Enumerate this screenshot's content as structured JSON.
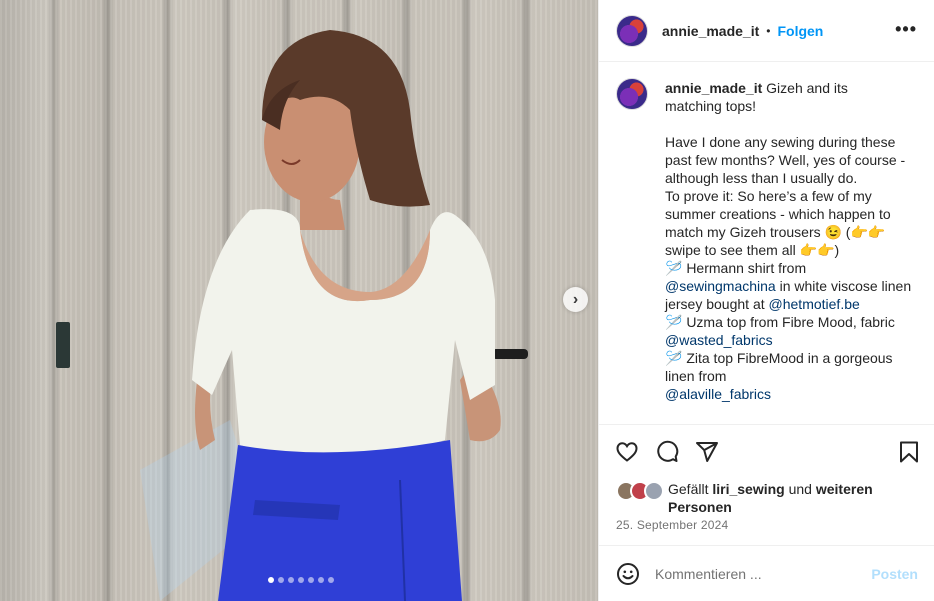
{
  "header": {
    "username": "annie_made_it",
    "separator": "•",
    "follow_label": "Folgen",
    "more_icon": "more-horizontal-icon"
  },
  "caption": {
    "username": "annie_made_it",
    "lines": [
      {
        "text": "Gizeh and its\nmatching tops!\n\nHave I done any sewing during these past few months? Well, yes of course - although less than I usually do.\nTo prove it: So here’s a few of my summer creations - which happen to match my Gizeh trousers 😉 (👉👉 swipe to see them all 👉👉)\n🪡 Hermann shirt from "
      },
      {
        "link": "@sewingmachina"
      },
      {
        "text": " in white viscose linen jersey bought at "
      },
      {
        "link": "@hetmotief.be"
      },
      {
        "text": "\n🪡 Uzma top from Fibre Mood, fabric "
      },
      {
        "link": "@wasted_fabrics"
      },
      {
        "text": "\n🪡 Zita top FibreMood in a gorgeous linen from\n"
      },
      {
        "link": "@alaville_fabrics"
      }
    ]
  },
  "likes": {
    "prefix": "Gefällt ",
    "user": "liri_sewing",
    "middle": " und ",
    "others": "weiteren Personen"
  },
  "date": "25. September 2024",
  "comment": {
    "placeholder": "Kommentieren ...",
    "post_label": "Posten"
  },
  "carousel": {
    "total_slides": 7,
    "active_slide": 1,
    "next_icon": "chevron-right-icon"
  },
  "colors": {
    "accent": "#0095f6",
    "link": "#00376b",
    "muted": "#737373",
    "post_disabled": "#b2dffc"
  }
}
